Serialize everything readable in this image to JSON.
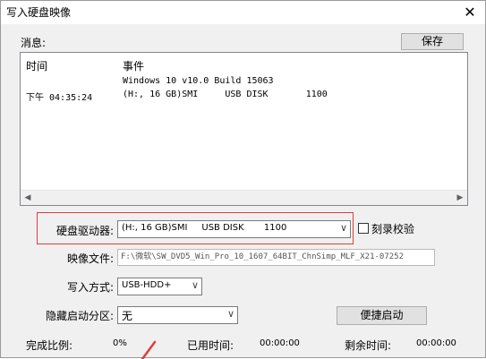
{
  "window": {
    "title": "写入硬盘映像",
    "close_symbol": "✕"
  },
  "messages": {
    "label": "消息:",
    "save_label": "保存",
    "columns": [
      "时间",
      "事件"
    ],
    "rows": [
      {
        "time": "",
        "event": "Windows 10 v10.0 Build 15063"
      },
      {
        "time": "下午 04:35:24",
        "event": "(H:, 16 GB)SMI     USB DISK       1100"
      }
    ]
  },
  "drive": {
    "label": "硬盘驱动器:",
    "value": "(H:, 16 GB)SMI     USB DISK       1100"
  },
  "verify": {
    "label": "刻录校验",
    "checked": false
  },
  "image_file": {
    "label": "映像文件:",
    "value": "F:\\微软\\SW_DVD5_Win_Pro_10_1607_64BIT_ChnSimp_MLF_X21-07252"
  },
  "write_mode": {
    "label": "写入方式:",
    "value": "USB-HDD+"
  },
  "hidden_partition": {
    "label": "隐藏启动分区:",
    "value": "无"
  },
  "boot_button": {
    "label": "便捷启动"
  },
  "status": {
    "done_label": "完成比例:",
    "done_value": "0%",
    "used_label": "已用时间:",
    "used_value": "00:00:00",
    "remain_label": "剩余时间:",
    "remain_value": "00:00:00"
  },
  "colors": {
    "highlight_box": "#e23b3b"
  }
}
